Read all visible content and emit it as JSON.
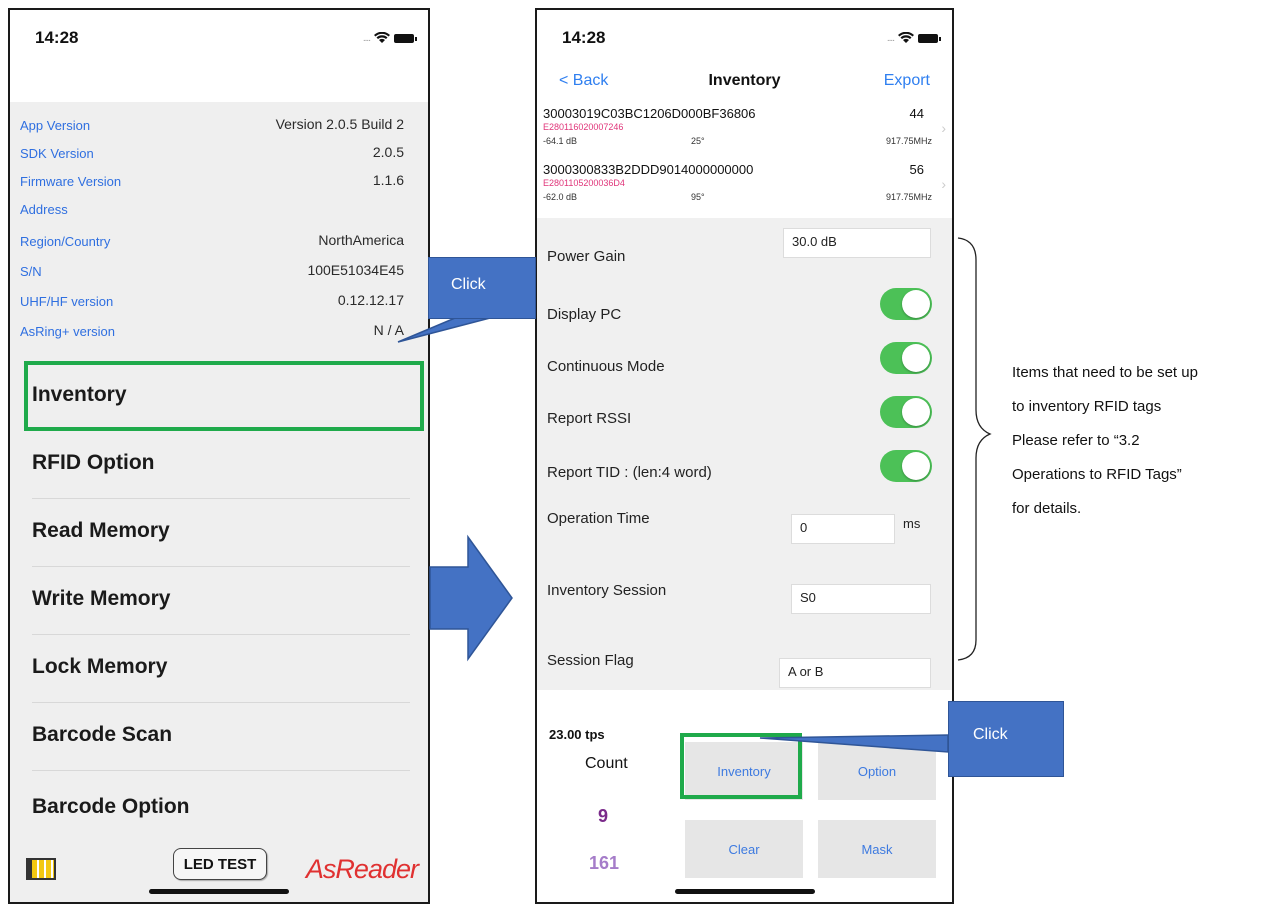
{
  "left_phone": {
    "time": "14:28",
    "info_rows": [
      {
        "label": "App Version",
        "value": "Version 2.0.5 Build 2"
      },
      {
        "label": "SDK Version",
        "value": "2.0.5"
      },
      {
        "label": "Firmware Version",
        "value": "1.1.6"
      },
      {
        "label": "Address",
        "value": ""
      },
      {
        "label": "Region/Country",
        "value": "NorthAmerica"
      },
      {
        "label": "S/N",
        "value": "100E51034E45"
      },
      {
        "label": "UHF/HF version",
        "value": "0.12.12.17"
      },
      {
        "label": "AsRing+ version",
        "value": "N / A"
      }
    ],
    "menu": [
      "Inventory",
      "RFID Option",
      "Read Memory",
      "Write Memory",
      "Lock Memory",
      "Barcode Scan",
      "Barcode Option"
    ],
    "led_button": "LED TEST",
    "logo": "AsReader"
  },
  "right_phone": {
    "time": "14:28",
    "nav": {
      "back": "< Back",
      "title": "Inventory",
      "export": "Export"
    },
    "tags": [
      {
        "epc": "30003019C03BC1206D000BF36806",
        "tid": "E280116020007246",
        "rssi": "-64.1 dB",
        "angle": "25°",
        "count": "44",
        "freq": "917.75MHz"
      },
      {
        "epc": "3000300833B2DDD9014000000000",
        "tid": "E2801105200036D4",
        "rssi": "-62.0 dB",
        "angle": "95°",
        "count": "56",
        "freq": "917.75MHz"
      }
    ],
    "settings": {
      "power_gain_label": "Power Gain",
      "power_gain_value": "30.0 dB",
      "display_pc": "Display PC",
      "continuous_mode": "Continuous Mode",
      "report_rssi": "Report RSSI",
      "report_tid": "Report TID : (len:4 word)",
      "operation_time_label": "Operation Time",
      "operation_time_value": "0",
      "operation_time_unit": "ms",
      "inventory_session_label": "Inventory Session",
      "inventory_session_value": "S0",
      "session_flag_label": "Session Flag",
      "session_flag_value": "A or B"
    },
    "toggles_on": [
      true,
      true,
      true,
      true
    ],
    "stats": {
      "tps": "23.00 tps",
      "count_label": "Count",
      "count_a": "9",
      "count_b": "161"
    },
    "buttons": {
      "inventory": "Inventory",
      "option": "Option",
      "clear": "Clear",
      "mask": "Mask"
    }
  },
  "annotations": {
    "click_1": "Click",
    "click_2": "Click",
    "note_lines": [
      "Items that need to be set up",
      "to inventory RFID tags",
      "Please refer to “3.2",
      "Operations to RFID Tags”",
      "for details."
    ]
  },
  "colors": {
    "highlight": "#1faa4b",
    "callout": "#4472c4",
    "link": "#2f7ff0",
    "toggle_on": "#4cc157"
  }
}
